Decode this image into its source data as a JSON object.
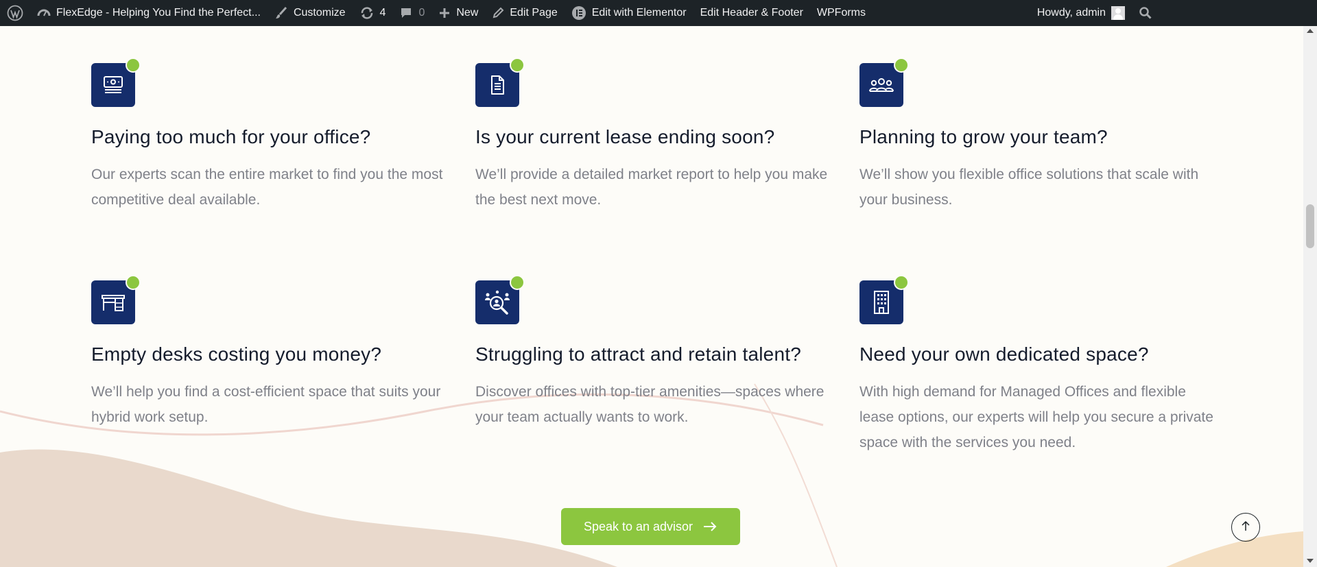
{
  "adminbar": {
    "wp_logo_icon": "wordpress-logo",
    "site_title": "FlexEdge - Helping You Find the Perfect...",
    "customize": "Customize",
    "updates_count": "4",
    "comments_count": "0",
    "new": "New",
    "edit_page": "Edit Page",
    "edit_elementor": "Edit with Elementor",
    "edit_header_footer": "Edit Header & Footer",
    "wpforms": "WPForms",
    "howdy": "Howdy, admin"
  },
  "features": [
    {
      "icon": "money-icon",
      "title": "Paying too much for your office?",
      "text": "Our experts scan the entire market to find you the most competitive deal available."
    },
    {
      "icon": "document-icon",
      "title": "Is your current lease ending soon?",
      "text": "We’ll provide a detailed market report to help you make the best next move."
    },
    {
      "icon": "team-icon",
      "title": "Planning to grow your team?",
      "text": "We’ll show you flexible office solutions that scale with your business."
    },
    {
      "icon": "desk-icon",
      "title": "Empty desks costing you money?",
      "text": "We’ll help you find a cost-efficient space that suits your hybrid work setup."
    },
    {
      "icon": "talent-search-icon",
      "title": "Struggling to attract and retain talent?",
      "text": "Discover offices with top-tier amenities—spaces where your team actually wants to work."
    },
    {
      "icon": "building-icon",
      "title": "Need your own dedicated space?",
      "text": "With high demand for Managed Offices and flexible lease options, our experts will help you secure a private space with the services you need."
    }
  ],
  "cta": {
    "label": "Speak to an advisor"
  },
  "colors": {
    "brand_navy": "#152d6b",
    "accent_green": "#8cc63f",
    "admin_bar": "#1d2327"
  }
}
